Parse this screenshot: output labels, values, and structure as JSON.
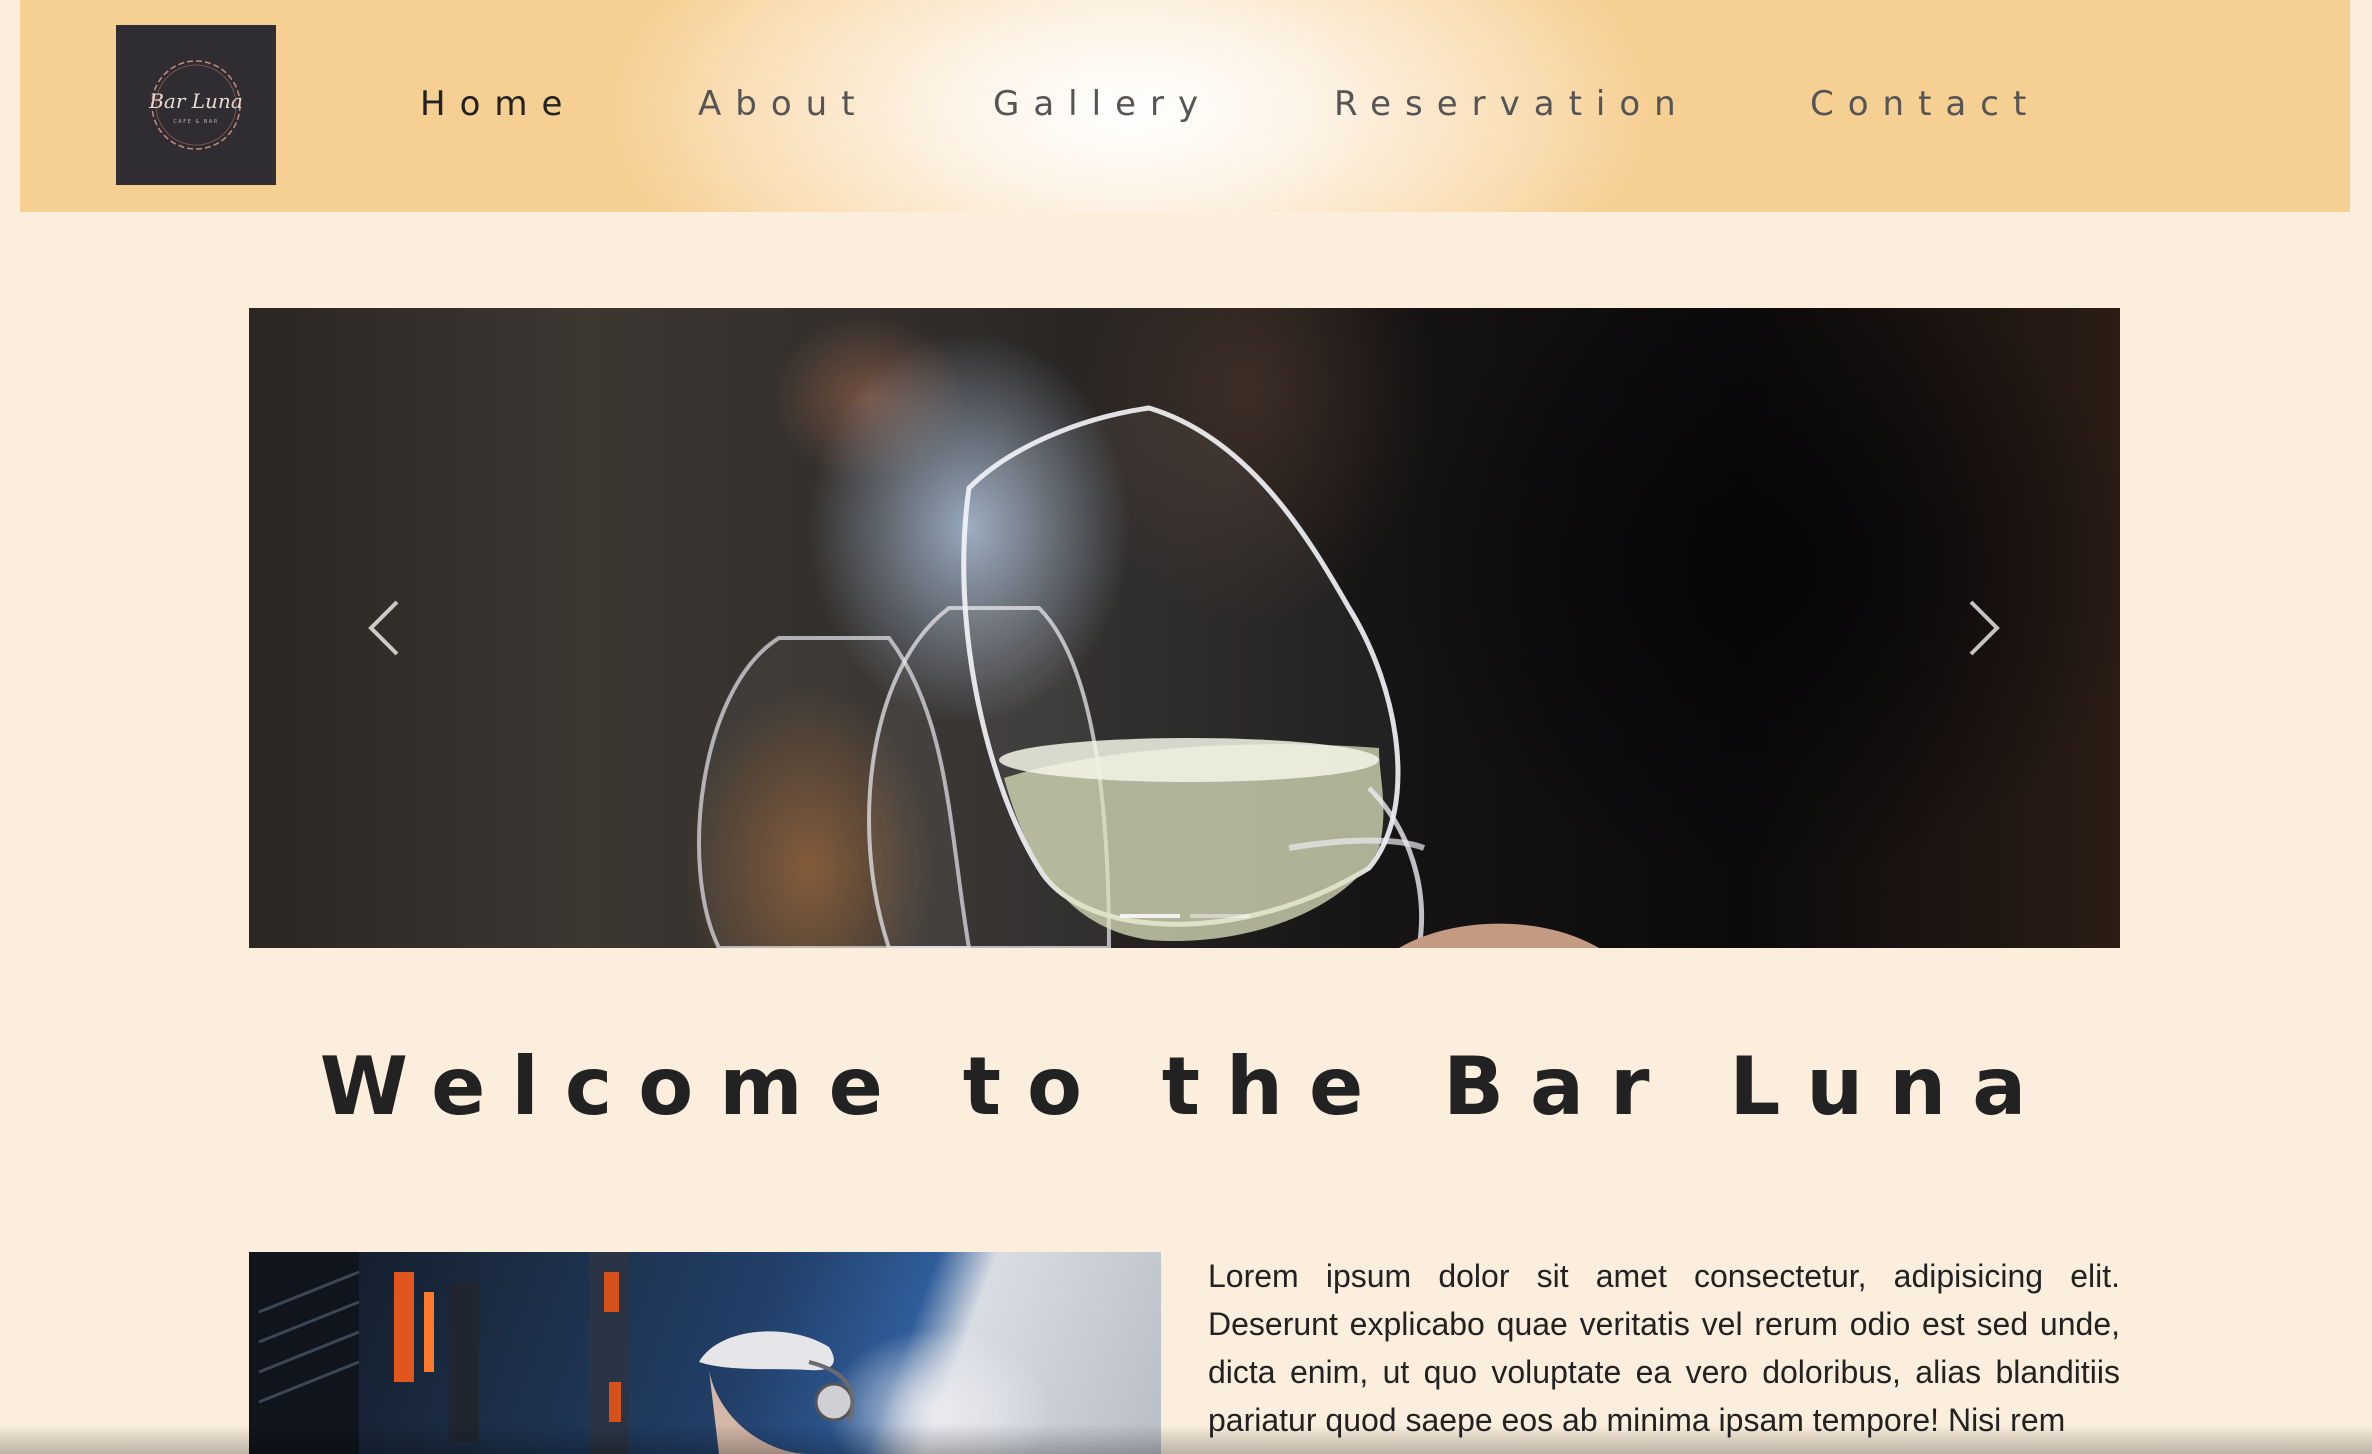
{
  "nav": {
    "logo_text": "Bar Luna",
    "logo_subtext": "CAFE & BAR",
    "items": [
      {
        "label": "Home",
        "active": true
      },
      {
        "label": "About",
        "active": false
      },
      {
        "label": "Gallery",
        "active": false
      },
      {
        "label": "Reservation",
        "active": false
      },
      {
        "label": "Contact",
        "active": false
      }
    ]
  },
  "carousel": {
    "prev_icon": "chevron-left-icon",
    "next_icon": "chevron-right-icon",
    "slide_count": 2,
    "active_slide": 1
  },
  "welcome": {
    "title": "Welcome to the Bar Luna"
  },
  "intro": {
    "paragraph": "Lorem ipsum dolor sit amet consectetur, adipisicing elit. Deserunt explicabo quae veritatis vel rerum odio est sed unde, dicta enim, ut quo voluptate ea vero doloribus, alias blanditiis pariatur quod saepe eos ab minima ipsam tempore! Nisi rem"
  },
  "colors": {
    "page_bg": "#fbeedd",
    "header_accent": "#f6cf93",
    "logo_bg": "#2f2d31",
    "text": "#222222"
  }
}
